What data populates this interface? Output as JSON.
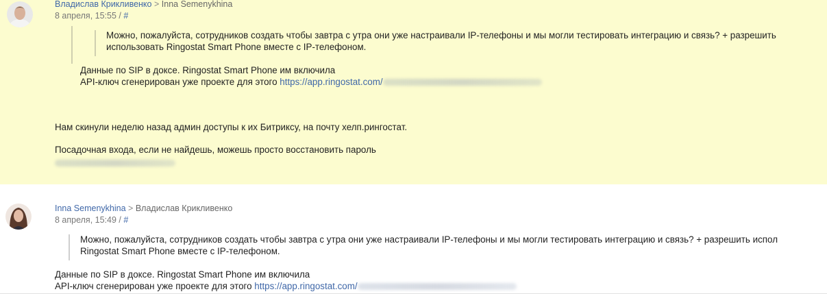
{
  "messages": [
    {
      "author": "Владислав Крикливенко",
      "arrow": ">",
      "recipient": "Inna Semenykhina",
      "date": "8 апреля, 15:55",
      "separator": "/",
      "hash": "#",
      "quote_line1": "Можно, пожалуйста, сотрудников создать чтобы завтра с утра они уже настраивали IP-телефоны и мы могли тестировать интеграцию и связь? + разрешить",
      "quote_line2": "использовать Ringostat Smart Phone вместе с IP-телефоном.",
      "sip_line1": "Данные по SIP в доксе. Ringostat Smart Phone им включила",
      "sip_line2_text": "API-ключ сгенерирован уже  проекте для этого ",
      "sip_link": "https://app.ringostat.com/",
      "sip_link_blurred": "project/custom_urls/project_inte...",
      "body_line1": "Нам скинули  неделю назад  админ доступы к их Битриксу, на почту хелп.рингостат.",
      "body_line2": "Посадочная входа, если не найдешь, можешь просто восстановить пароль",
      "body_line3_blurred": "novatek-electro.bitrix24.ua",
      "background": "#fcfccf"
    },
    {
      "author": "Inna Semenykhina",
      "arrow": ">",
      "recipient": "Владислав Крикливенко",
      "date": "8 апреля, 15:49",
      "separator": "/",
      "hash": "#",
      "quote_line1": "Можно, пожалуйста, сотрудников создать чтобы завтра с утра они уже настраивали IP-телефоны и мы могли тестировать интеграцию и связь? + разрешить испол",
      "quote_line2": "Ringostat Smart Phone вместе с IP-телефоном.",
      "sip_line1": "Данные по SIP в доксе. Ringostat Smart Phone им включила",
      "sip_line2_text": "API-ключ сгенерирован уже  проекте для этого ",
      "sip_link": "https://app.ringostat.com/",
      "sip_link_blurred": "project/custom_urls/project_inte...",
      "background": "#ffffff"
    }
  ],
  "colors": {
    "link": "#3f67a8",
    "highlight": "#fcfccf",
    "meta": "#777777"
  }
}
